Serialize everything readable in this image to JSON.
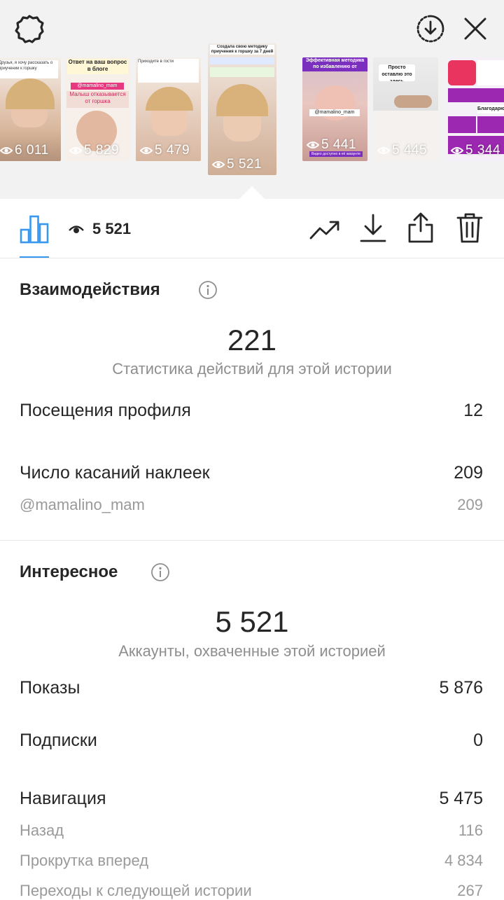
{
  "header": {
    "settings_icon": "gear-icon",
    "download_icon": "download-circle-icon",
    "close_icon": "close-icon"
  },
  "stories": [
    {
      "views": "6 011",
      "caption": "Друзья, я хочу рассказать о приучении к горшку"
    },
    {
      "views": "5 829",
      "caption": "Ответ на ваш вопрос в блоге",
      "tag": "@mamalino_mam",
      "sub": "Малыш отказывается от горшка"
    },
    {
      "views": "5 479",
      "caption": "Приходите в гости"
    },
    {
      "views": "5 521",
      "caption": "Создала свою методику приучения к горшку за 7 дней",
      "selected": true
    },
    {
      "views": "5 441",
      "caption": "Эффективная методика по избавлению от «коликов»",
      "tag": "@mamalino_mam",
      "sub": "Видео доступно в её аккаунте"
    },
    {
      "views": "5 445",
      "caption": "Просто оставлю это здесь"
    },
    {
      "views": "5 344",
      "caption": "Благодарю"
    }
  ],
  "toolbar": {
    "views": "5 521",
    "chart_icon": "bar-chart-icon",
    "eye_icon": "eye-icon",
    "promote_icon": "trending-up-icon",
    "save_icon": "download-icon",
    "share_icon": "share-icon",
    "delete_icon": "trash-icon"
  },
  "interactions": {
    "title": "Взаимодействия",
    "total": "221",
    "caption": "Статистика действий для этой истории",
    "rows": [
      {
        "label": "Посещения профиля",
        "value": "12"
      },
      {
        "label": "Число касаний наклеек",
        "value": "209"
      }
    ],
    "sub_rows": [
      {
        "label": "@mamalino_mam",
        "value": "209"
      }
    ]
  },
  "discovery": {
    "title": "Интересное",
    "total": "5 521",
    "caption": "Аккаунты, охваченные этой историей",
    "rows": [
      {
        "label": "Показы",
        "value": "5 876"
      },
      {
        "label": "Подписки",
        "value": "0"
      },
      {
        "label": "Навигация",
        "value": "5 475"
      }
    ],
    "sub_rows": [
      {
        "label": "Назад",
        "value": "116"
      },
      {
        "label": "Прокрутка вперед",
        "value": "4 834"
      },
      {
        "label": "Переходы к следующей истории",
        "value": "267"
      }
    ]
  },
  "colors": {
    "accent": "#3897f0",
    "text": "#262626",
    "secondary": "#8e8e8e",
    "top_bg": "#f2f2f2"
  }
}
